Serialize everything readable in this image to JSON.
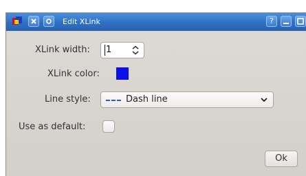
{
  "window": {
    "title": "Edit XLink",
    "buttons": {
      "help": "?"
    }
  },
  "form": {
    "width_label": "XLink width:",
    "width_value": "1",
    "color_label": "XLink color:",
    "color_value": "#0c10e8",
    "style_label": "Line style:",
    "style_value": "Dash line",
    "default_label": "Use as default:",
    "default_checked": false
  },
  "actions": {
    "ok_label": "Ok"
  },
  "icons": [
    "app-icon",
    "close-icon",
    "pin-icon",
    "help-icon",
    "minimize-icon",
    "maximize-icon",
    "spin-arrows-icon",
    "dash-line-icon",
    "chevron-down-icon"
  ]
}
